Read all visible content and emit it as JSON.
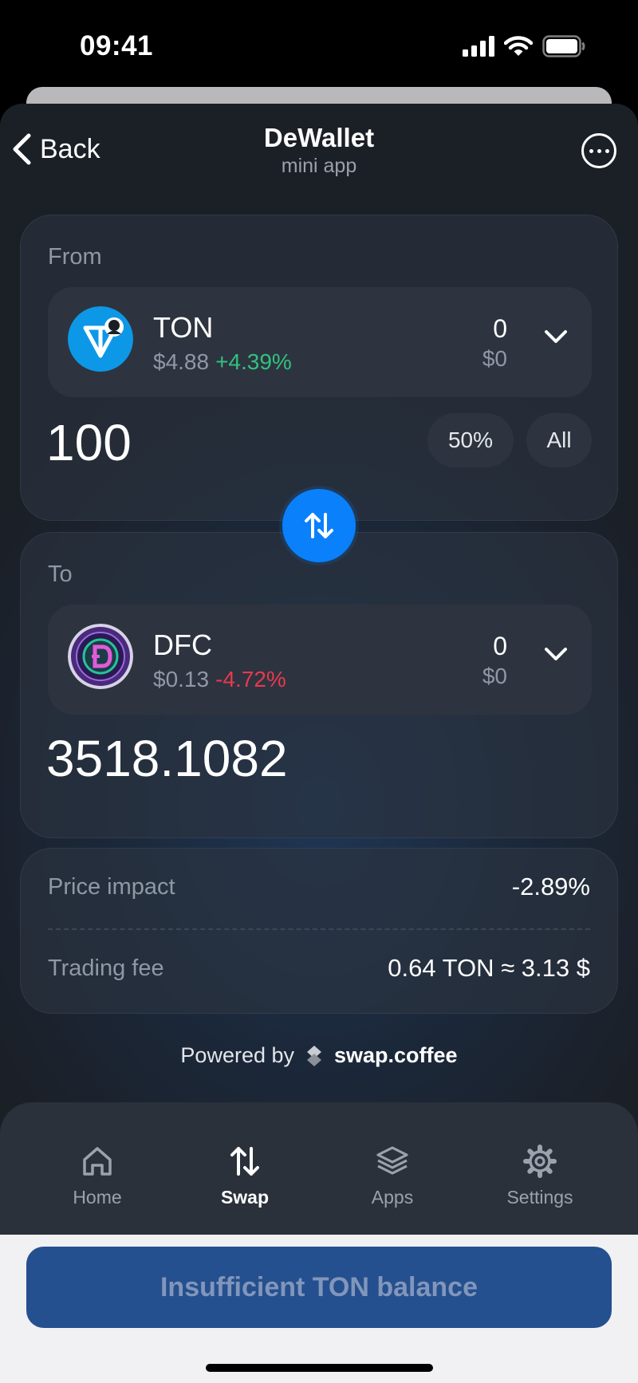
{
  "status_bar": {
    "time": "09:41"
  },
  "header": {
    "back_label": "Back",
    "title": "DeWallet",
    "subtitle": "mini app"
  },
  "from": {
    "label": "From",
    "token": {
      "symbol": "TON",
      "price": "$4.88",
      "change": "+4.39%",
      "balance": "0",
      "balance_usd": "$0"
    },
    "amount": "100",
    "quick_buttons": [
      "50%",
      "All"
    ]
  },
  "to": {
    "label": "To",
    "token": {
      "symbol": "DFC",
      "price": "$0.13",
      "change": "-4.72%",
      "balance": "0",
      "balance_usd": "$0"
    },
    "amount": "3518.1082"
  },
  "info": {
    "price_impact_label": "Price impact",
    "price_impact_value": "-2.89%",
    "trading_fee_label": "Trading fee",
    "trading_fee_value": "0.64 TON ≈ 3.13 $"
  },
  "powered": {
    "prefix": "Powered by",
    "brand": "swap.coffee"
  },
  "tabs": [
    {
      "label": "Home",
      "icon": "home-icon",
      "active": false
    },
    {
      "label": "Swap",
      "icon": "swap-icon",
      "active": true
    },
    {
      "label": "Apps",
      "icon": "layers-icon",
      "active": false
    },
    {
      "label": "Settings",
      "icon": "gear-icon",
      "active": false
    }
  ],
  "cta": {
    "label": "Insufficient TON balance"
  },
  "colors": {
    "accent": "#0a80fb",
    "positive": "#31c27c",
    "negative": "#e9384e",
    "cta_bg": "#25508f"
  }
}
